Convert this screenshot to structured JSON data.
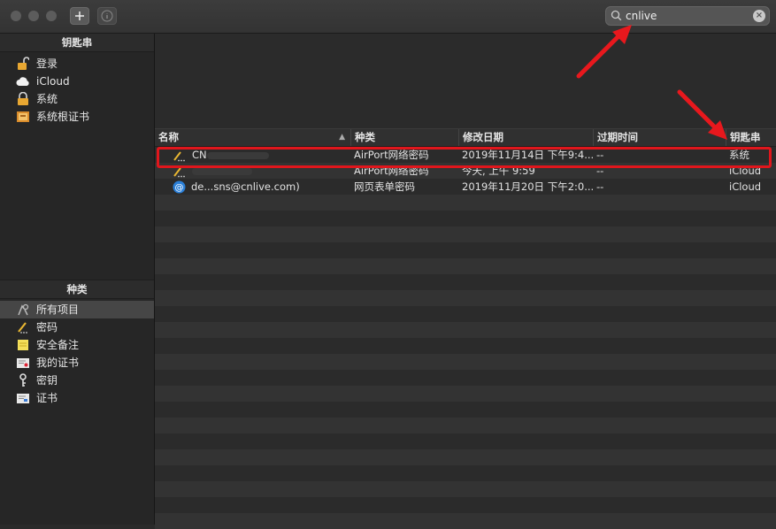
{
  "search": {
    "value": "cnlive",
    "placeholder": ""
  },
  "sidebar": {
    "keychains_header": "钥匙串",
    "keychains": [
      {
        "label": "登录",
        "icon": "lock-open-icon"
      },
      {
        "label": "iCloud",
        "icon": "cloud-icon"
      },
      {
        "label": "系统",
        "icon": "lock-icon"
      },
      {
        "label": "系统根证书",
        "icon": "cabinet-icon"
      }
    ],
    "categories_header": "种类",
    "categories": [
      {
        "label": "所有项目",
        "icon": "all-items-icon"
      },
      {
        "label": "密码",
        "icon": "password-icon"
      },
      {
        "label": "安全备注",
        "icon": "note-icon"
      },
      {
        "label": "我的证书",
        "icon": "certificate-icon"
      },
      {
        "label": "密钥",
        "icon": "key-icon"
      },
      {
        "label": "证书",
        "icon": "certificate-icon"
      }
    ]
  },
  "table": {
    "columns": [
      "名称",
      "种类",
      "修改日期",
      "过期时间",
      "钥匙串"
    ],
    "rows": [
      {
        "name": "CN",
        "kind": "AirPort网络密码",
        "modified": "2019年11月14日 下午9:4...",
        "expires": "--",
        "keychain": "系统"
      },
      {
        "name": "",
        "kind": "AirPort网络密码",
        "modified": "今天, 上午 9:59",
        "expires": "--",
        "keychain": "iCloud"
      },
      {
        "name": "de...sns@cnlive.com)",
        "kind": "网页表单密码",
        "modified": "2019年11月20日 下午2:0...",
        "expires": "--",
        "keychain": "iCloud"
      }
    ]
  },
  "colors": {
    "highlight_red": "#e0161c",
    "selected_row": "#464646"
  }
}
